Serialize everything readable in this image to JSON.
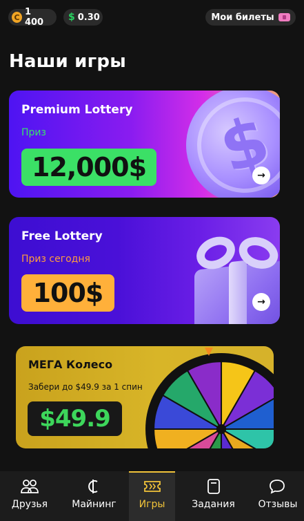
{
  "topbar": {
    "coins": "1 400",
    "coin_symbol": "C",
    "money": "0.30",
    "money_symbol": "$",
    "tickets_label": "Мои билеты"
  },
  "page_title": "Наши игры",
  "cards": {
    "premium": {
      "title": "Premium Lottery",
      "subtitle": "Приз",
      "prize": "12,000$",
      "art_symbol": "$"
    },
    "free": {
      "title": "Free Lottery",
      "subtitle": "Приз сегодня",
      "prize": "100$"
    },
    "mega": {
      "title": "МЕГА Колесо",
      "subtitle": "Забери до $49.9 за 1 спин",
      "prize": "$49.9"
    }
  },
  "nav": {
    "items": [
      {
        "label": "Друзья"
      },
      {
        "label": "Майнинг"
      },
      {
        "label": "Игры"
      },
      {
        "label": "Задания"
      },
      {
        "label": "Отзывы"
      }
    ],
    "active_index": 2
  },
  "colors": {
    "background": "#121212",
    "accent_green": "#3be066",
    "accent_orange": "#ffb03a",
    "nav_active": "#f2c43a"
  }
}
